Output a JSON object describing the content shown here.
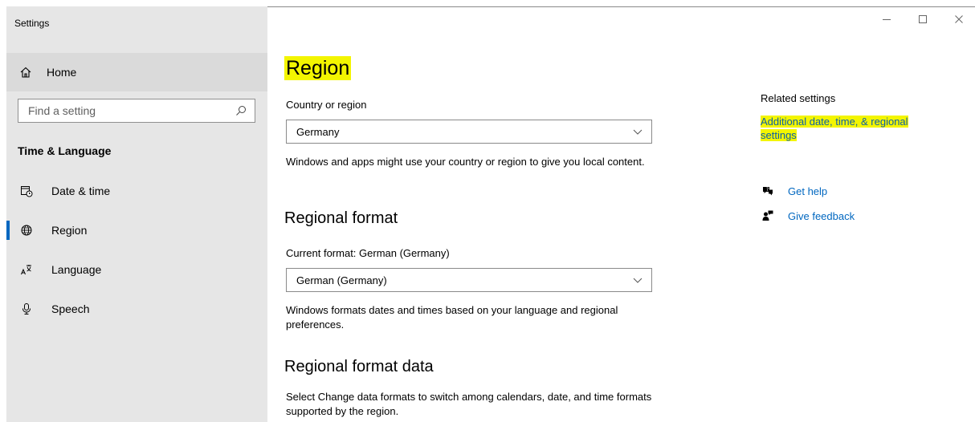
{
  "window": {
    "title": "Settings",
    "controls": {
      "minimize_icon": "minimize-icon",
      "maximize_icon": "maximize-icon",
      "close_icon": "close-icon"
    }
  },
  "sidebar": {
    "home_label": "Home",
    "search": {
      "placeholder": "Find a setting"
    },
    "section_title": "Time & Language",
    "items": [
      {
        "label": "Date & time",
        "icon": "calendar-clock-icon",
        "active": false
      },
      {
        "label": "Region",
        "icon": "globe-icon",
        "active": true
      },
      {
        "label": "Language",
        "icon": "language-icon",
        "active": false
      },
      {
        "label": "Speech",
        "icon": "microphone-icon",
        "active": false
      }
    ]
  },
  "main": {
    "title": "Region",
    "country": {
      "label": "Country or region",
      "value": "Germany",
      "description": "Windows and apps might use your country or region to give you local content."
    },
    "regional_format": {
      "heading": "Regional format",
      "current_label": "Current format: German (Germany)",
      "value": "German (Germany)",
      "description": "Windows formats dates and times based on your language and regional preferences."
    },
    "regional_format_data": {
      "heading": "Regional format data",
      "description": "Select Change data formats to switch among calendars, date, and time formats supported by the region."
    }
  },
  "related": {
    "title": "Related settings",
    "link": "Additional date, time, & regional settings",
    "help_label": "Get help",
    "feedback_label": "Give feedback"
  },
  "colors": {
    "accent": "#0067c0",
    "highlight": "#f3f500",
    "sidebar_bg": "#e6e6e6"
  }
}
